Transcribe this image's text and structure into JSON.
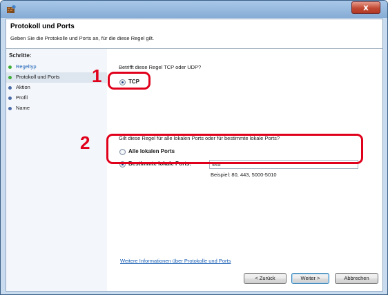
{
  "window": {
    "close_glyph": "x",
    "header": {
      "title": "Protokoll und Ports",
      "subtitle": "Geben Sie die Protokolle und Ports an, für die diese Regel gilt."
    },
    "sidebar": {
      "heading": "Schritte:",
      "steps": [
        {
          "label": "Regeltyp",
          "state": "done"
        },
        {
          "label": "Protokoll und Ports",
          "state": "current"
        },
        {
          "label": "Aktion",
          "state": "pending"
        },
        {
          "label": "Profil",
          "state": "pending"
        },
        {
          "label": "Name",
          "state": "pending"
        }
      ]
    },
    "content": {
      "question1": "Betrifft diese Regel TCP oder UDP?",
      "tcp_label": "TCP",
      "question2": "Gilt diese Regel für alle lokalen Ports oder für bestimmte lokale Ports?",
      "all_ports_label": "Alle lokalen Ports",
      "specific_ports_label": "Bestimmte lokale Ports:",
      "ports_value": "445",
      "example_text": "Beispiel: 80, 443, 5000-5010",
      "more_info_link": "Weitere Informationen über Protokolle und Ports"
    },
    "buttons": {
      "back": "< Zurück",
      "next": "Weiter >",
      "cancel": "Abbrechen"
    },
    "annotations": [
      "1",
      "2"
    ],
    "colors": {
      "highlight": "#e0001b",
      "link": "#1a5fb4",
      "done_dot": "#3fae3a",
      "pending_dot": "#4b6aa8"
    }
  }
}
